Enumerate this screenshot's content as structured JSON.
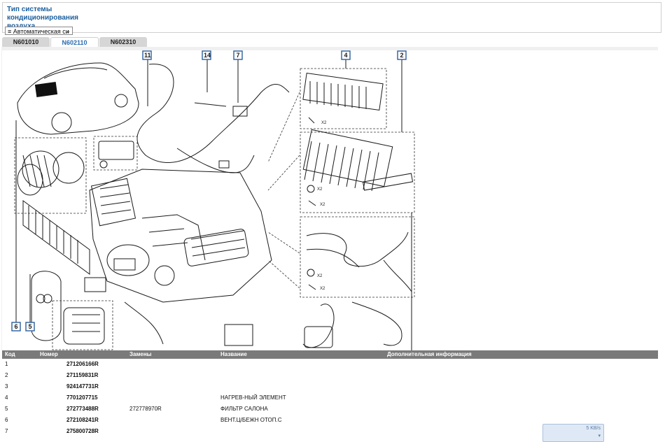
{
  "filter": {
    "title_lines": [
      "Тип системы",
      "кондиционирования",
      "воздуха."
    ],
    "select_value": "≡ Автоматическая си"
  },
  "tabs": [
    {
      "label": "N601010",
      "active": false
    },
    {
      "label": "N602110",
      "active": true
    },
    {
      "label": "N602310",
      "active": false
    }
  ],
  "diagram": {
    "callouts": [
      "11",
      "14",
      "7",
      "4",
      "2",
      "6",
      "5"
    ],
    "multipliers": [
      "X2",
      "X2",
      "X2",
      "X2",
      "X2"
    ]
  },
  "table": {
    "headers": {
      "code": "Код",
      "number": "Номер",
      "replacements": "Замены",
      "name": "Название",
      "info": "Дополнительная информация"
    },
    "rows": [
      {
        "code": "1",
        "number": "271206166R",
        "replacement": "",
        "name": "",
        "info": ""
      },
      {
        "code": "2",
        "number": "271159831R",
        "replacement": "",
        "name": "",
        "info": ""
      },
      {
        "code": "3",
        "number": "924147731R",
        "replacement": "",
        "name": "",
        "info": ""
      },
      {
        "code": "4",
        "number": "7701207715",
        "replacement": "",
        "name": "НАГРЕВ-НЫЙ ЭЛЕМЕНТ",
        "info": ""
      },
      {
        "code": "5",
        "number": "272773488R",
        "replacement": "272778970R",
        "name": "ФИЛЬТР САЛОНА",
        "info": ""
      },
      {
        "code": "6",
        "number": "272108241R",
        "replacement": "",
        "name": "ВЕНТ.Ц/БЕЖН ОТОП.С",
        "info": ""
      },
      {
        "code": "7",
        "number": "275800728R",
        "replacement": "",
        "name": "",
        "info": ""
      }
    ]
  },
  "widget": {
    "speed": "5 KB/s"
  },
  "colors": {
    "accent": "#1b5f9e",
    "tag_border": "#2a5f9e",
    "table_header": "#7a7a7a"
  }
}
